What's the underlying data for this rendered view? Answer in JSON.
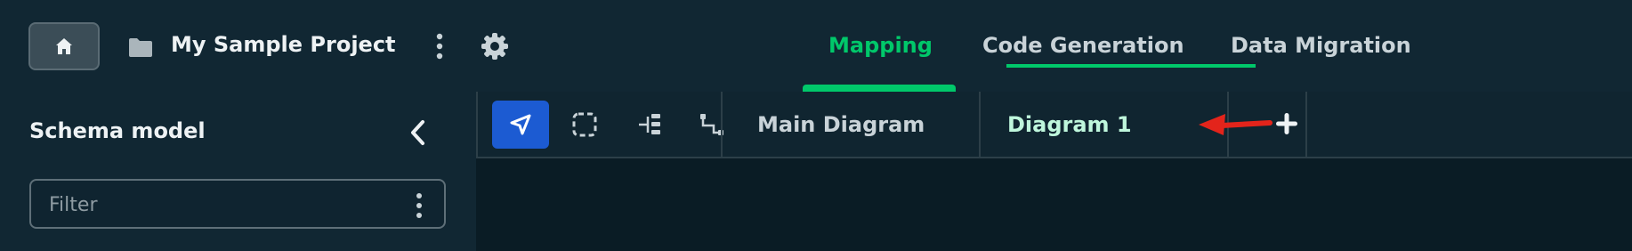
{
  "header": {
    "project_name": "My Sample Project",
    "tabs": [
      {
        "label": "Mapping",
        "active": true
      },
      {
        "label": "Code Generation",
        "active": false
      },
      {
        "label": "Data Migration",
        "active": false
      }
    ]
  },
  "sidebar": {
    "title": "Schema model",
    "filter": {
      "placeholder": "Filter",
      "value": ""
    }
  },
  "diagram_toolbar": {
    "tools": [
      {
        "icon": "pointer-icon",
        "active": true
      },
      {
        "icon": "marquee-select-icon",
        "active": false
      },
      {
        "icon": "tree-layout-icon",
        "active": false
      },
      {
        "icon": "relationship-connector-icon",
        "active": false
      }
    ],
    "diagram_tabs": [
      {
        "label": "Main Diagram",
        "active": false
      },
      {
        "label": "Diagram 1",
        "active": true
      }
    ]
  },
  "colors": {
    "accent_green": "#00c86a",
    "active_tool_blue": "#1c5bd2",
    "annotation_red": "#e3241b"
  }
}
